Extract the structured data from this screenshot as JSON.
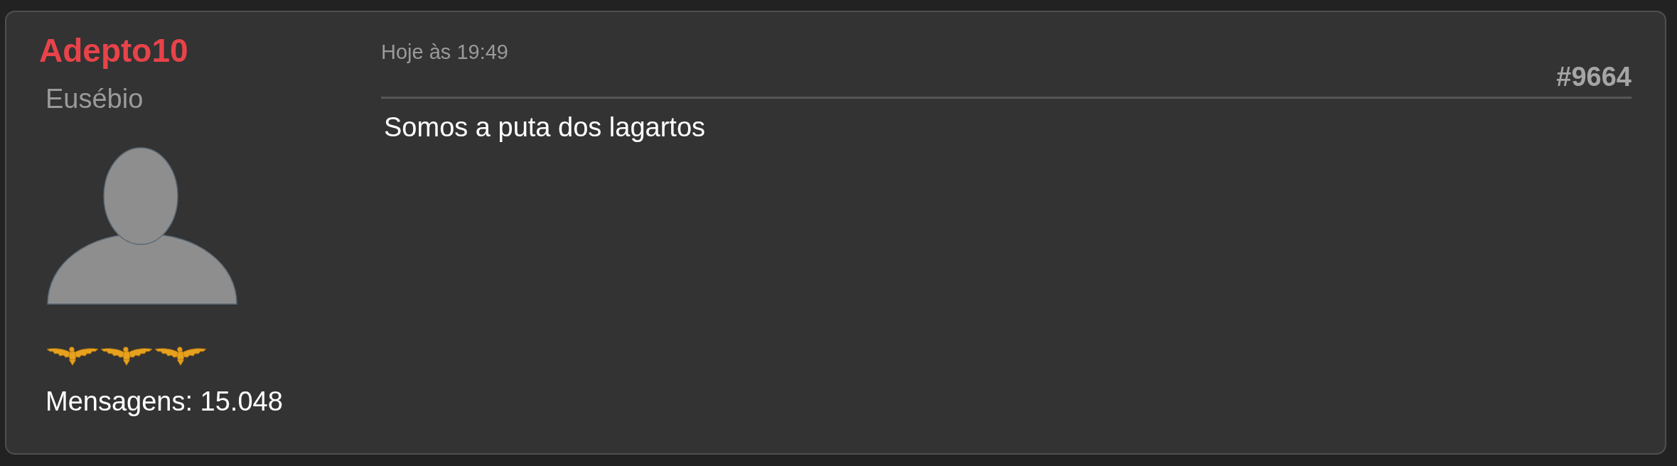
{
  "post": {
    "author": {
      "username": "Adepto10",
      "rank_title": "Eusébio",
      "stars": 3,
      "message_count": "Mensagens: 15.048"
    },
    "timestamp": "Hoje às 19:49",
    "number": "#9664",
    "body": "Somos a puta dos lagartos"
  }
}
